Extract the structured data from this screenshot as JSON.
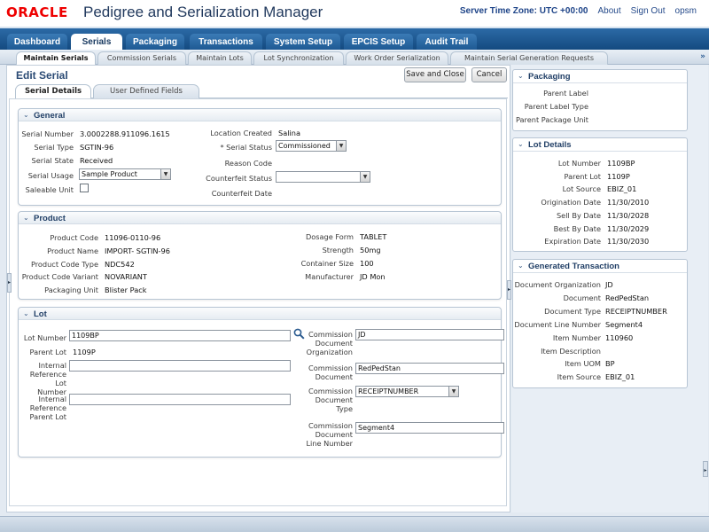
{
  "header": {
    "logo": "ORACLE",
    "title": "Pedigree and Serialization Manager",
    "server_time_zone": "Server Time Zone: UTC +00:00",
    "links": [
      "About",
      "Sign Out",
      "opsm"
    ]
  },
  "main_tabs": [
    "Dashboard",
    "Serials",
    "Packaging",
    "Transactions",
    "System Setup",
    "EPCIS Setup",
    "Audit Trail"
  ],
  "sub_tabs": [
    "Maintain Serials",
    "Commission Serials",
    "Maintain Lots",
    "Lot Synchronization",
    "Work Order Serialization",
    "Maintain Serial Generation Requests"
  ],
  "page": {
    "title": "Edit Serial",
    "save_close": "Save and Close",
    "cancel": "Cancel",
    "inner_tabs": [
      "Serial Details",
      "User Defined Fields"
    ]
  },
  "general": {
    "title": "General",
    "serial_number_label": "Serial Number",
    "serial_number": "3.0002288.911096.1615",
    "serial_type_label": "Serial Type",
    "serial_type": "SGTIN-96",
    "serial_state_label": "Serial State",
    "serial_state": "Received",
    "serial_usage_label": "Serial Usage",
    "serial_usage": "Sample Product",
    "saleable_unit_label": "Saleable Unit",
    "location_created_label": "Location Created",
    "location_created": "Salina",
    "serial_status_label": "* Serial Status",
    "serial_status": "Commissioned",
    "reason_code_label": "Reason Code",
    "counterfeit_status_label": "Counterfeit Status",
    "counterfeit_status": "",
    "counterfeit_date_label": "Counterfeit Date"
  },
  "product": {
    "title": "Product",
    "product_code_label": "Product Code",
    "product_code": "11096-0110-96",
    "product_name_label": "Product Name",
    "product_name": "IMPORT- SGTIN-96",
    "product_code_type_label": "Product Code Type",
    "product_code_type": "NDC542",
    "product_code_variant_label": "Product Code Variant",
    "product_code_variant": "NOVARIANT",
    "packaging_unit_label": "Packaging Unit",
    "packaging_unit": "Blister Pack",
    "dosage_form_label": "Dosage Form",
    "dosage_form": "TABLET",
    "strength_label": "Strength",
    "strength": "50mg",
    "container_size_label": "Container Size",
    "container_size": "100",
    "manufacturer_label": "Manufacturer",
    "manufacturer": "JD Mon"
  },
  "lot": {
    "title": "Lot",
    "lot_number_label": "Lot Number",
    "lot_number": "1109BP",
    "parent_lot_label": "Parent Lot",
    "parent_lot": "1109P",
    "internal_ref_lot_label": "Internal Reference Lot Number",
    "internal_ref_lot": "",
    "internal_ref_parent_label": "Internal Reference Parent Lot",
    "internal_ref_parent": "",
    "commission_org_label": "Commission Document Organization",
    "commission_org": "JD",
    "commission_doc_label": "Commission Document",
    "commission_doc": "RedPedStan",
    "commission_doc_type_label": "Commission Document Type",
    "commission_doc_type": "RECEIPTNUMBER",
    "commission_line_label": "Commission Document Line Number",
    "commission_line": "Segment4"
  },
  "packaging": {
    "title": "Packaging",
    "labels": [
      "Parent Label",
      "Parent Label Type",
      "Parent Package Unit"
    ]
  },
  "lot_details": {
    "title": "Lot Details",
    "rows": [
      {
        "label": "Lot Number",
        "value": "1109BP"
      },
      {
        "label": "Parent Lot",
        "value": "1109P"
      },
      {
        "label": "Lot Source",
        "value": "EBIZ_01"
      },
      {
        "label": "Origination Date",
        "value": "11/30/2010"
      },
      {
        "label": "Sell By Date",
        "value": "11/30/2028"
      },
      {
        "label": "Best By Date",
        "value": "11/30/2029"
      },
      {
        "label": "Expiration Date",
        "value": "11/30/2030"
      }
    ]
  },
  "generated_transaction": {
    "title": "Generated Transaction",
    "rows": [
      {
        "label": "Document Organization",
        "value": "JD"
      },
      {
        "label": "Document",
        "value": "RedPedStan"
      },
      {
        "label": "Document Type",
        "value": "RECEIPTNUMBER"
      },
      {
        "label": "Document Line Number",
        "value": "Segment4"
      },
      {
        "label": "Item Number",
        "value": "110960"
      },
      {
        "label": "Item Description",
        "value": ""
      },
      {
        "label": "Item UOM",
        "value": "BP"
      },
      {
        "label": "Item Source",
        "value": "EBIZ_01"
      }
    ]
  }
}
